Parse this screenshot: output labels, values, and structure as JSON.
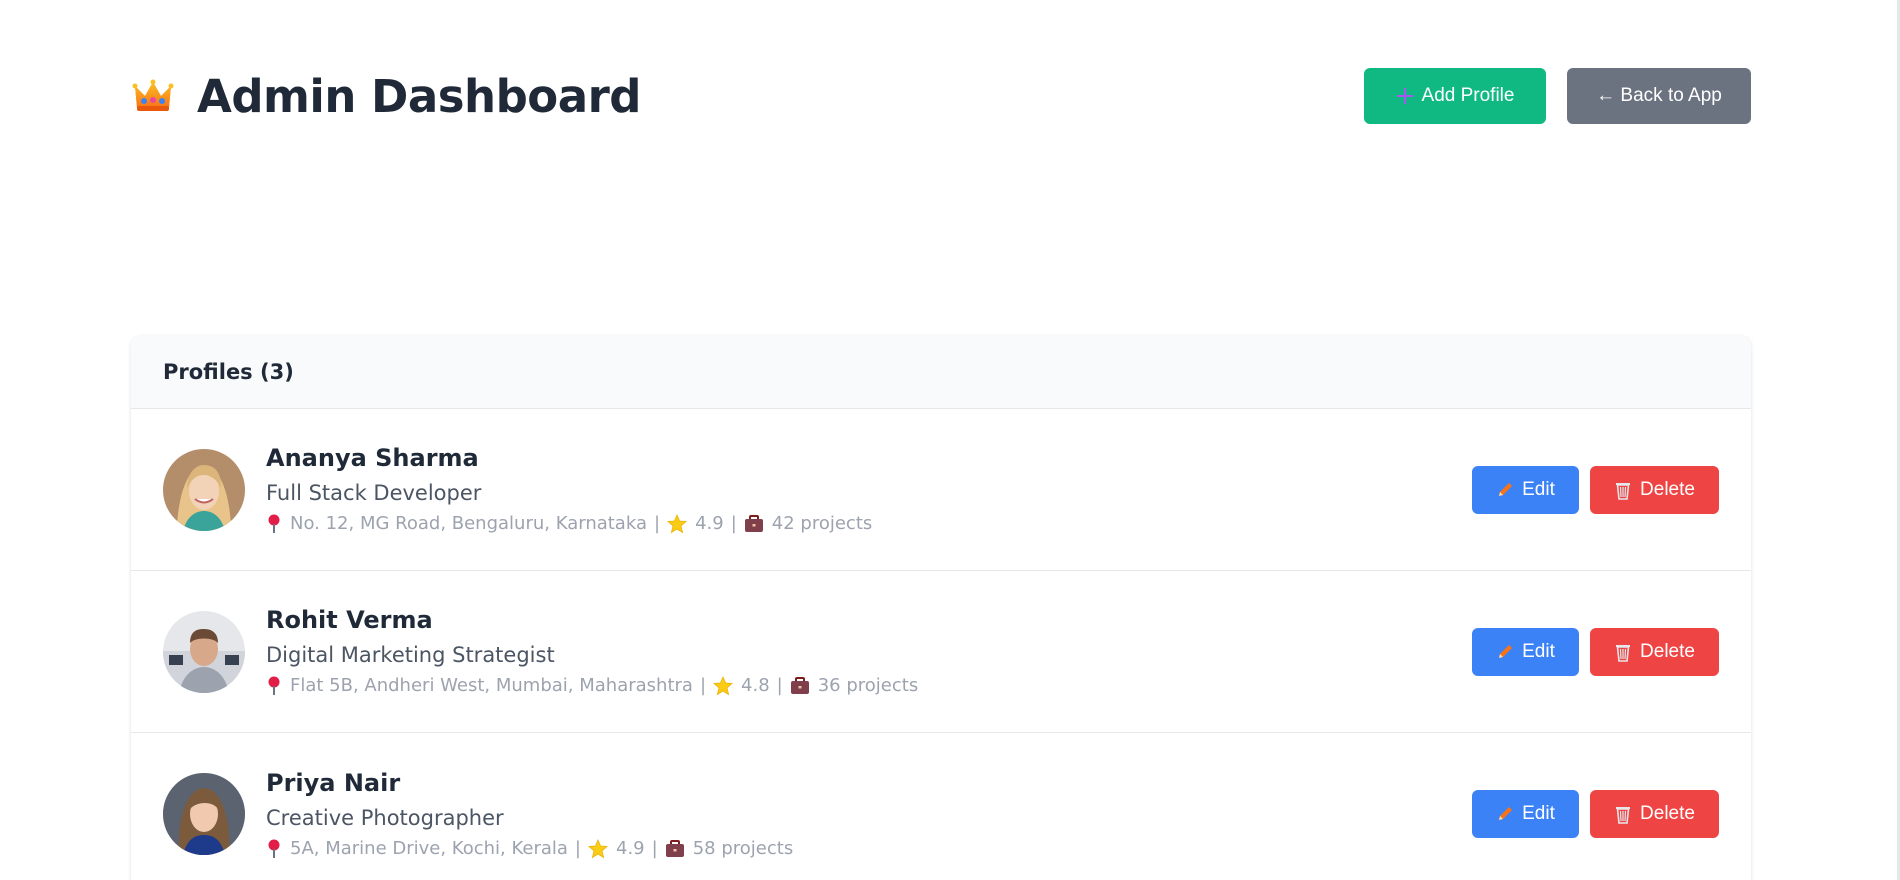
{
  "header": {
    "title": "Admin Dashboard",
    "add_label": "Add Profile",
    "back_label": "← Back to App",
    "icons": {
      "title": "crown-icon",
      "add": "plus-icon"
    }
  },
  "panel": {
    "title": "Profiles (3)"
  },
  "profiles": [
    {
      "name": "Ananya Sharma",
      "role": "Full Stack Developer",
      "address": "No. 12, MG Road, Bengaluru, Karnataka",
      "rating": "4.9",
      "projects": "42 projects",
      "edit_label": "Edit",
      "delete_label": "Delete"
    },
    {
      "name": "Rohit Verma",
      "role": "Digital Marketing Strategist",
      "address": "Flat 5B, Andheri West, Mumbai, Maharashtra",
      "rating": "4.8",
      "projects": "36 projects",
      "edit_label": "Edit",
      "delete_label": "Delete"
    },
    {
      "name": "Priya Nair",
      "role": "Creative Photographer",
      "address": "5A, Marine Drive, Kochi, Kerala",
      "rating": "4.9",
      "projects": "58 projects",
      "edit_label": "Edit",
      "delete_label": "Delete"
    }
  ],
  "separator": "|",
  "colors": {
    "add_button": "#10b981",
    "back_button": "#6b7280",
    "edit_button": "#3b82f6",
    "delete_button": "#ef4444",
    "panel_header_bg": "#f8fafc",
    "meta_text": "#9ca3af"
  },
  "icons": {
    "location": "location-pin-icon",
    "rating": "star-icon",
    "projects": "briefcase-icon",
    "edit": "pencil-icon",
    "delete": "trash-icon"
  }
}
